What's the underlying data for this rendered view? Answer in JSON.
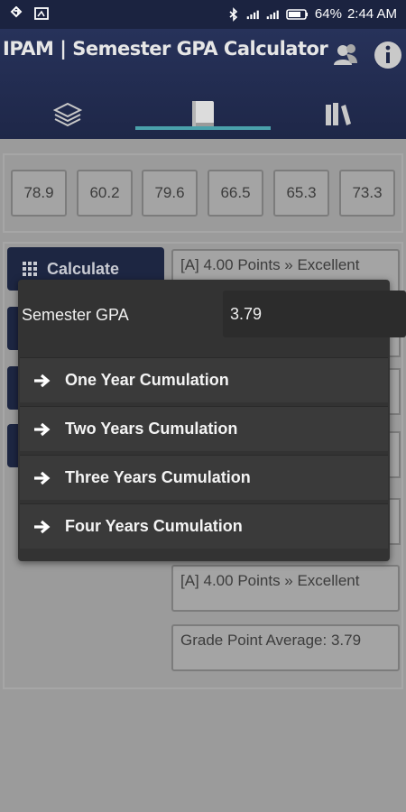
{
  "status_bar": {
    "battery": "64%",
    "time": "2:44 AM"
  },
  "app": {
    "title": "IPAM | Semester GPA Calculator"
  },
  "scores": [
    "78.9",
    "60.2",
    "79.6",
    "66.5",
    "65.3",
    "73.3"
  ],
  "calculate_label": "Calculate",
  "results": {
    "top": "[A] 4.00 Points » Excellent",
    "bottom": "[A] 4.00 Points » Excellent",
    "gpa_line": "Grade Point Average: 3.79"
  },
  "popup": {
    "gpa_label": "Semester GPA",
    "gpa_value": "3.79",
    "items": [
      {
        "label": "One Year Cumulation"
      },
      {
        "label": "Two Years Cumulation"
      },
      {
        "label": "Three Years Cumulation"
      },
      {
        "label": "Four Years Cumulation"
      }
    ]
  },
  "colors": {
    "header": "#1e2748",
    "accent": "#4aa1ab",
    "popup": "#333333"
  }
}
